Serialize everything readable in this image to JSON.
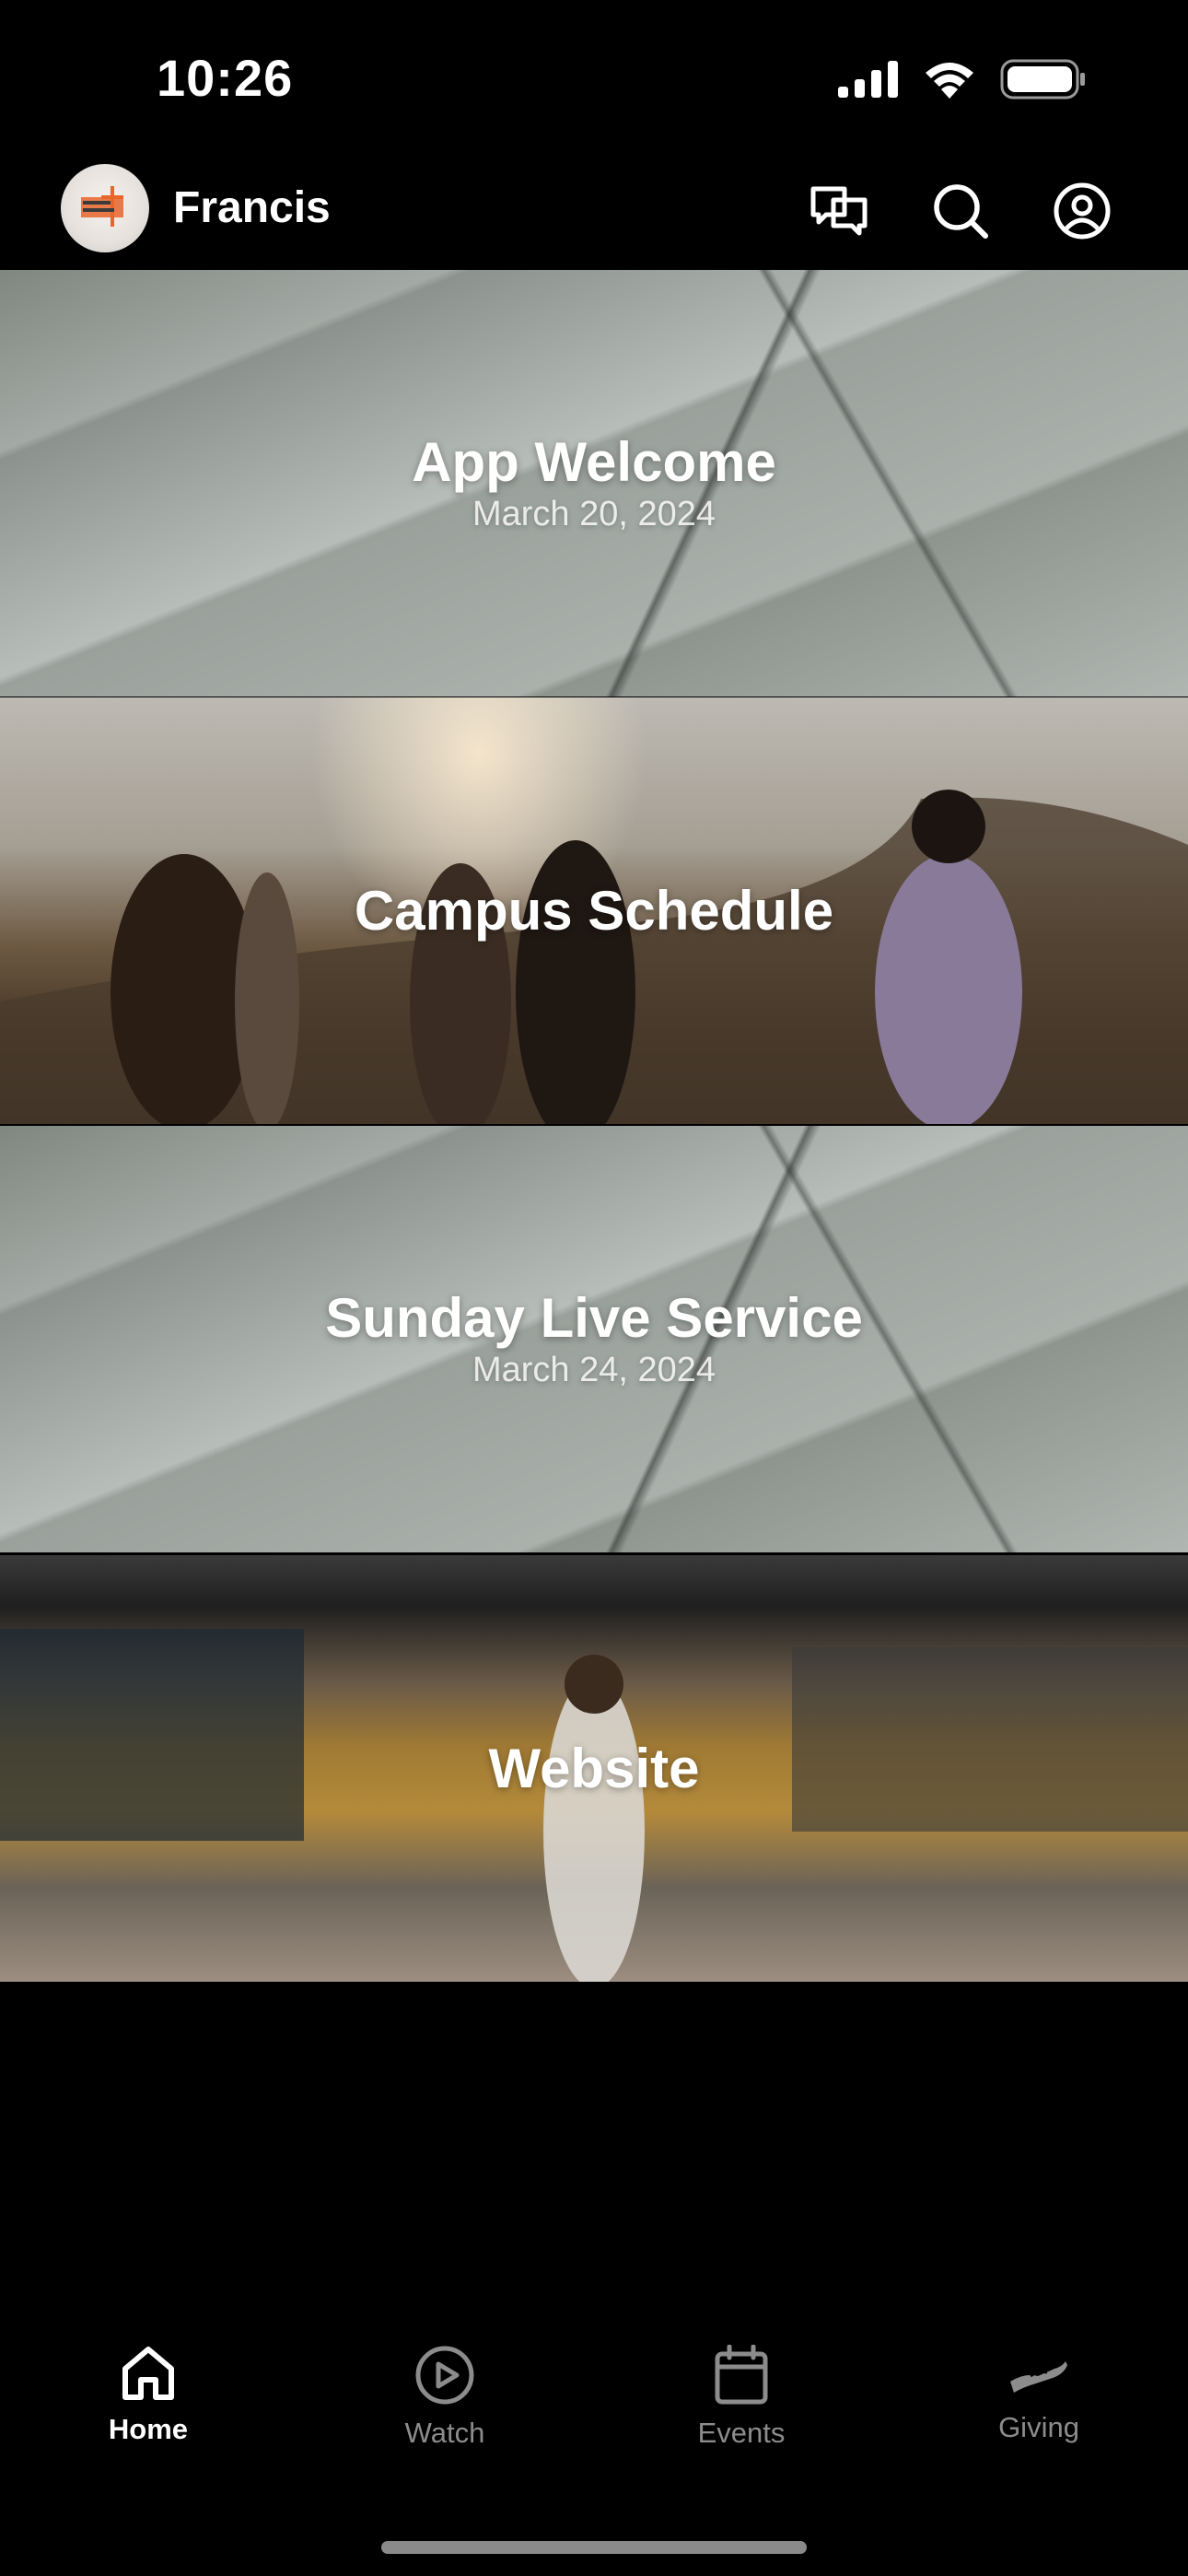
{
  "status_bar": {
    "time": "10:26",
    "icons": [
      "cellular-signal-icon",
      "wifi-icon",
      "battery-icon"
    ]
  },
  "header": {
    "title": "Francis",
    "avatar_logo_text": "FRANCIS BAPTIST",
    "actions": [
      "chat-icon",
      "search-icon",
      "profile-icon"
    ]
  },
  "feed": {
    "items": [
      {
        "title": "App Welcome",
        "subtitle": "March 20, 2024"
      },
      {
        "title": "Campus Schedule",
        "subtitle": ""
      },
      {
        "title": "Sunday Live Service",
        "subtitle": "March 24, 2024"
      },
      {
        "title": "Website",
        "subtitle": ""
      }
    ]
  },
  "tabbar": {
    "tabs": [
      {
        "label": "Home",
        "icon": "home-icon",
        "active": true
      },
      {
        "label": "Watch",
        "icon": "play-circle-icon",
        "active": false
      },
      {
        "label": "Events",
        "icon": "calendar-icon",
        "active": false
      },
      {
        "label": "Giving",
        "icon": "giving-hand-icon",
        "active": false
      }
    ]
  },
  "colors": {
    "background": "#000000",
    "active_tab": "#ffffff",
    "inactive_tab": "#8c8c8c",
    "avatar_accent": "#e8652b"
  }
}
